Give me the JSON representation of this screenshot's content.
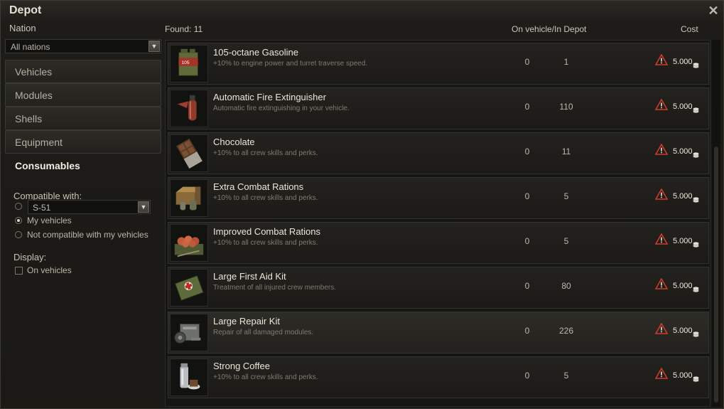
{
  "window": {
    "title": "Depot",
    "close_symbol": "✕"
  },
  "headers": {
    "nation": "Nation",
    "found": "Found: 11",
    "on_vehicle_in_depot": "On vehicle/In Depot",
    "cost": "Cost"
  },
  "nation_select": {
    "value": "All nations"
  },
  "categories": [
    {
      "label": "Vehicles"
    },
    {
      "label": "Modules"
    },
    {
      "label": "Shells"
    },
    {
      "label": "Equipment"
    },
    {
      "label": "Consumables"
    }
  ],
  "filters": {
    "compatible_label": "Compatible with:",
    "vehicle_select": "S-51",
    "my_vehicles": "My vehicles",
    "not_compatible": "Not compatible with my vehicles",
    "display_label": "Display:",
    "on_vehicles": "On vehicles"
  },
  "items": [
    {
      "name": "105-octane Gasoline",
      "desc": "+10% to engine power and turret traverse speed.",
      "on_vehicle": "0",
      "in_depot": "1",
      "price": "5.000",
      "icon": "gasoline-can-icon"
    },
    {
      "name": "Automatic Fire Extinguisher",
      "desc": "Automatic fire extinguishing in your vehicle.",
      "on_vehicle": "0",
      "in_depot": "110",
      "price": "5.000",
      "icon": "fire-extinguisher-icon"
    },
    {
      "name": "Chocolate",
      "desc": "+10% to all crew skills and perks.",
      "on_vehicle": "0",
      "in_depot": "11",
      "price": "5.000",
      "icon": "chocolate-icon"
    },
    {
      "name": "Extra Combat Rations",
      "desc": "+10% to all crew skills and perks.",
      "on_vehicle": "0",
      "in_depot": "5",
      "price": "5.000",
      "icon": "rations-box-icon"
    },
    {
      "name": "Improved Combat Rations",
      "desc": "+10% to all crew skills and perks.",
      "on_vehicle": "0",
      "in_depot": "5",
      "price": "5.000",
      "icon": "food-tray-icon"
    },
    {
      "name": "Large First Aid Kit",
      "desc": "Treatment of all injured crew members.",
      "on_vehicle": "0",
      "in_depot": "80",
      "price": "5.000",
      "icon": "first-aid-kit-icon"
    },
    {
      "name": "Large Repair Kit",
      "desc": "Repair of all damaged modules.",
      "on_vehicle": "0",
      "in_depot": "226",
      "price": "5.000",
      "icon": "repair-kit-icon"
    },
    {
      "name": "Strong Coffee",
      "desc": "+10% to all crew skills and perks.",
      "on_vehicle": "0",
      "in_depot": "5",
      "price": "5.000",
      "icon": "coffee-thermos-icon"
    }
  ],
  "colors": {
    "warning": "#d13a2a",
    "accent_text": "#eae7d8",
    "background": "#1b1a17"
  }
}
